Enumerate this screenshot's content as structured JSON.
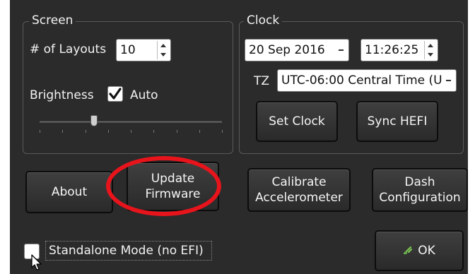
{
  "screen_group": {
    "title": "Screen",
    "layouts_label": "# of Layouts",
    "layouts_value": "10",
    "brightness_label": "Brightness",
    "auto_label": "Auto",
    "auto_checked": true,
    "brightness_level": 0.3
  },
  "clock_group": {
    "title": "Clock",
    "date_value": "20 Sep 2016",
    "time_value": "11:26:25",
    "tz_label": "TZ",
    "tz_value": "UTC-06:00 Central Time (U",
    "set_clock_label": "Set Clock",
    "sync_label": "Sync HEFI"
  },
  "buttons": {
    "about": "About",
    "update_line1": "Update",
    "update_line2": "Firmware",
    "calibrate_line1": "Calibrate",
    "calibrate_line2": "Accelerometer",
    "dash_line1": "Dash",
    "dash_line2": "Configuration",
    "ok": "OK"
  },
  "standalone": {
    "label": "Standalone Mode (no EFI)",
    "checked": false
  },
  "colors": {
    "panel": "#2b2b2b",
    "highlight": "#e8141c",
    "ok_icon": "#7ec850"
  }
}
